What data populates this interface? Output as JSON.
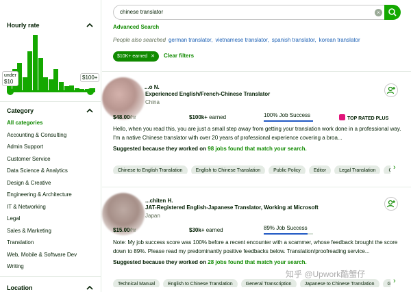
{
  "sidebar": {
    "hourly_rate": {
      "title": "Hourly rate",
      "histogram": [
        0.32,
        0.4,
        0.5,
        0.25,
        0.7,
        0.98,
        0.58,
        0.26,
        0.22,
        0.4,
        0.18,
        0.1,
        0.12,
        0.07,
        0.06,
        0.06,
        0.07
      ],
      "min_label_line1": "under",
      "min_label_line2": "$10",
      "max_label": "$100+"
    },
    "category": {
      "title": "Category",
      "items": [
        {
          "label": "All categories",
          "active": true
        },
        {
          "label": "Accounting & Consulting"
        },
        {
          "label": "Admin Support"
        },
        {
          "label": "Customer Service"
        },
        {
          "label": "Data Science & Analytics"
        },
        {
          "label": "Design & Creative"
        },
        {
          "label": "Engineering & Architecture"
        },
        {
          "label": "IT & Networking"
        },
        {
          "label": "Legal"
        },
        {
          "label": "Sales & Marketing"
        },
        {
          "label": "Translation"
        },
        {
          "label": "Web, Mobile & Software Dev"
        },
        {
          "label": "Writing"
        }
      ]
    },
    "location": {
      "title": "Location"
    }
  },
  "search": {
    "value": "chinese translator",
    "advanced_label": "Advanced Search",
    "people_also_label": "People also searched",
    "suggestions": [
      "german translator,",
      "vietnamese translator,",
      "spanish translator,",
      "korean translator"
    ],
    "active_filter": "$10K+ earned",
    "clear_filters": "Clear filters"
  },
  "freelancers": [
    {
      "name": "...o N.",
      "title": "Experienced English/French-Chinese Translator",
      "country": "China",
      "rate": "$48.00",
      "rate_unit": "/hr",
      "earned": "$100k+",
      "earned_label": " earned",
      "job_success": "100% Job Success",
      "job_success_value": 1.0,
      "badge": "TOP RATED PLUS",
      "description": "Hello, when you read this, you are just a small step away from getting your translation work done in a professional way. I'm a native Chinese translator with over 20 years of professional experience covering a broa...",
      "suggested_prefix": "Suggested because they worked on ",
      "suggested_link": "98 jobs found that match your search.",
      "tags": [
        "Chinese to English Translation",
        "English to Chinese Translation",
        "Public Policy",
        "Editor",
        "Legal Translation",
        "G..."
      ]
    },
    {
      "name": "...chiten H.",
      "title": "JAT-Registered English-Japanese Translator, Working at Microsoft",
      "country": "Japan",
      "rate": "$15.00",
      "rate_unit": "/hr",
      "earned": "$30k+",
      "earned_label": " earned",
      "job_success": "89% Job Success",
      "job_success_value": 0.89,
      "badge": "",
      "description": "Note: My job success score was 100% before a recent encounter with a scammer, whose feedback brought the score down to 89%. Please read my predominantly positive feedbacks below. Translation/proofreading service...",
      "suggested_prefix": "Suggested because they worked on ",
      "suggested_link": "28 jobs found that match your search.",
      "tags": [
        "Technical Manual",
        "English to Chinese Translation",
        "General Transcription",
        "Japanese to Chinese Translation",
        "G..."
      ]
    }
  ],
  "watermark": "知乎 @Upwork酷蟹仔",
  "colors": {
    "accent": "#14a800",
    "link": "#1a5fb4",
    "jss_bar": "#1f57c3",
    "badge": "#e1137a"
  }
}
